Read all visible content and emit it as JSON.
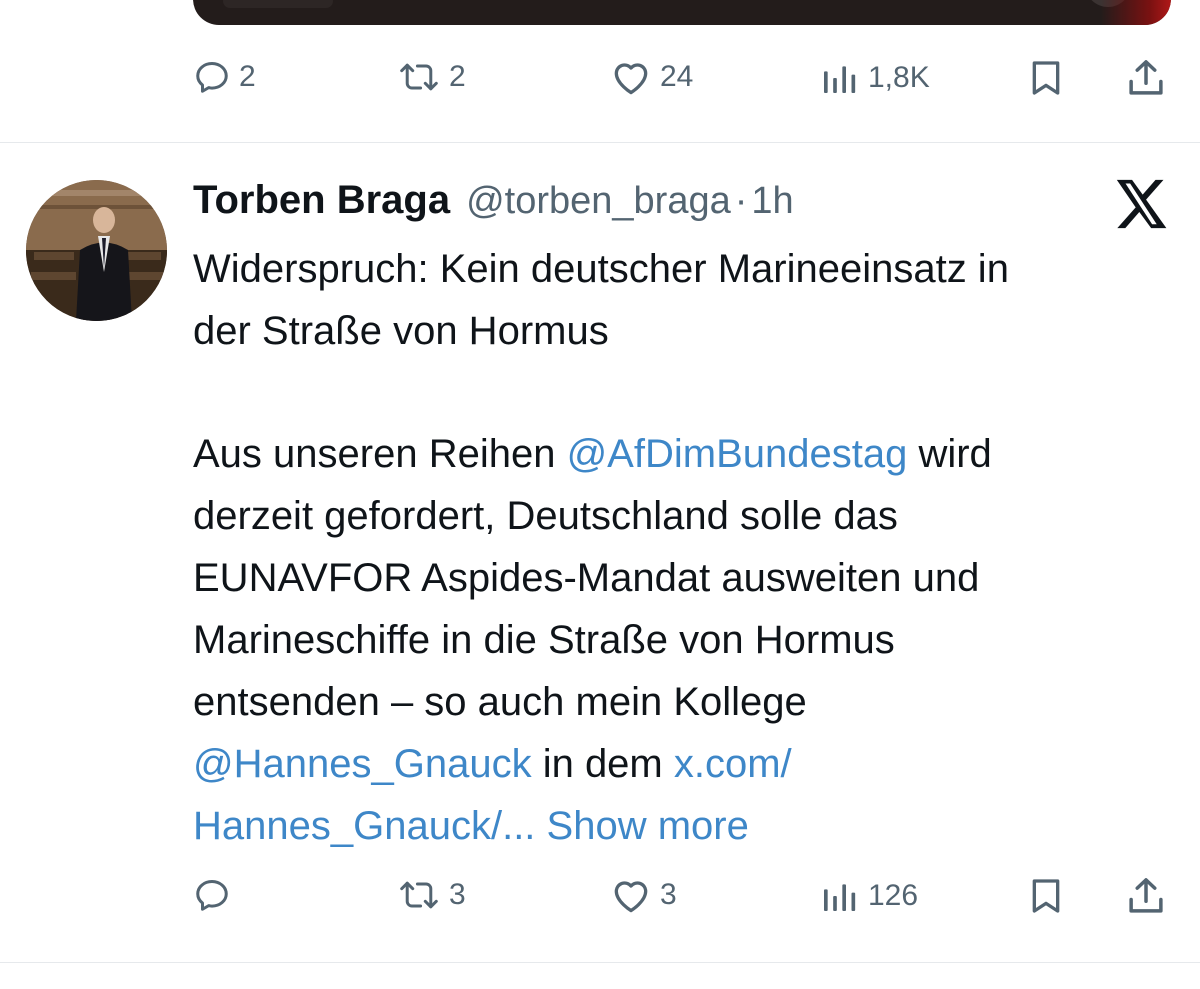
{
  "previous_tweet": {
    "actions": {
      "replies": "2",
      "reposts": "2",
      "likes": "24",
      "views": "1,8K"
    }
  },
  "tweet": {
    "author_name": "Torben Braga",
    "author_handle": "@torben_braga",
    "separator": "·",
    "time": "1h",
    "line1": "Widerspruch: Kein deutscher Marineeinsatz in",
    "line2": "der Straße von Hormus",
    "line3_pre": "Aus unseren Reihen ",
    "mention1": "@AfDimBundestag",
    "line3_post": " wird",
    "line4": "derzeit gefordert, Deutschland solle das",
    "line5": "EUNAVFOR Aspides-Mandat ausweiten und",
    "line6": "Marineschiffe in die Straße von Hormus",
    "line7": "entsenden – so auch mein Kollege",
    "mention2": "@Hannes_Gnauck",
    "line8_mid": " in dem ",
    "link_part1": "x.com/",
    "link_part2": "Hannes_Gnauck/...",
    "show_more": "Show more",
    "actions": {
      "reposts": "3",
      "likes": "3",
      "views": "126"
    }
  },
  "icons": {
    "reply": "reply-icon",
    "repost": "repost-icon",
    "like": "heart-icon",
    "views": "views-icon",
    "bookmark": "bookmark-icon",
    "share": "share-icon",
    "platform": "x-logo-icon"
  },
  "colors": {
    "link": "#3e87c8",
    "muted": "#536471",
    "text": "#0f1419",
    "divider": "#e6e9ec"
  }
}
